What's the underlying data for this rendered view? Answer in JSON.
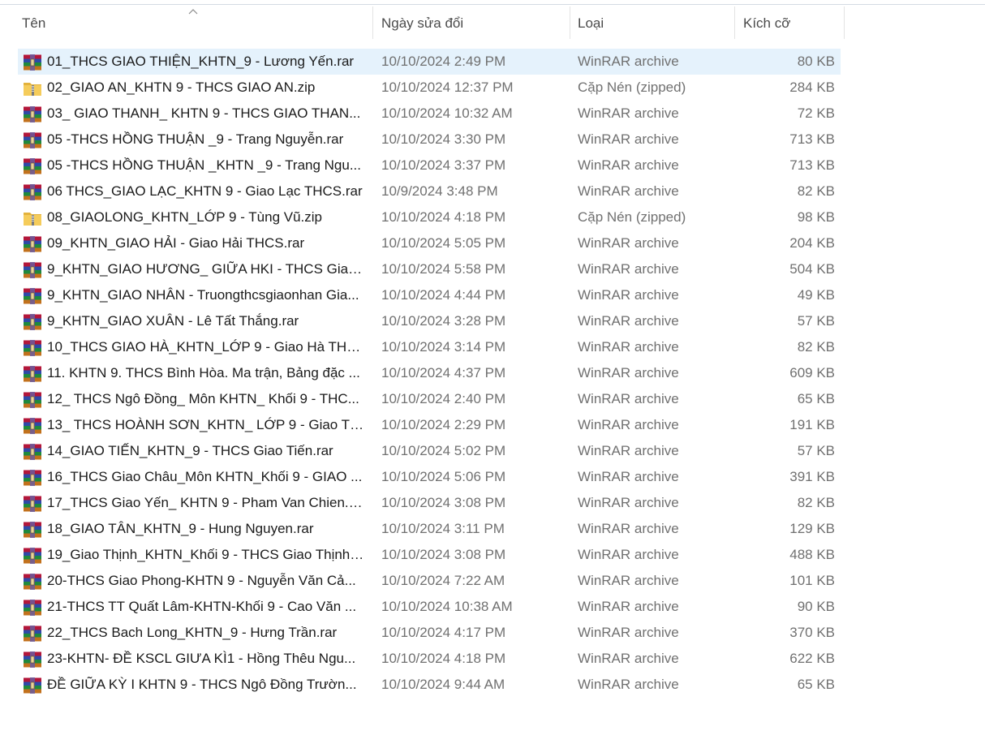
{
  "columns": {
    "name": "Tên",
    "date": "Ngày sửa đổi",
    "type": "Loại",
    "size": "Kích cỡ"
  },
  "sort": {
    "column": "name",
    "direction": "ascending",
    "indicator": "chevron-up-icon"
  },
  "selected_index": 0,
  "colors": {
    "selected": "#e5f2fc",
    "secondary_text": "#707070"
  },
  "files": [
    {
      "icon": "winrar-archive-icon",
      "name": "01_THCS GIAO THIỆN_KHTN_9 - Lương Yến.rar",
      "date": "10/10/2024 2:49 PM",
      "type": "WinRAR archive",
      "size": "80 KB"
    },
    {
      "icon": "zip-folder-icon",
      "name": "02_GIAO AN_KHTN 9 - THCS GIAO AN.zip",
      "date": "10/10/2024 12:37 PM",
      "type": "Cặp Nén (zipped)",
      "size": "284 KB"
    },
    {
      "icon": "winrar-archive-icon",
      "name": "03_ GIAO THANH_ KHTN 9 - THCS GIAO THAN...",
      "date": "10/10/2024 10:32 AM",
      "type": "WinRAR archive",
      "size": "72 KB"
    },
    {
      "icon": "winrar-archive-icon",
      "name": "05 -THCS HỒNG THUẬN _9 - Trang Nguyễn.rar",
      "date": "10/10/2024 3:30 PM",
      "type": "WinRAR archive",
      "size": "713 KB"
    },
    {
      "icon": "winrar-archive-icon",
      "name": "05 -THCS HỒNG THUẬN _KHTN _9 - Trang Ngu...",
      "date": "10/10/2024 3:37 PM",
      "type": "WinRAR archive",
      "size": "713 KB"
    },
    {
      "icon": "winrar-archive-icon",
      "name": "06 THCS_GIAO LẠC_KHTN 9 - Giao Lạc THCS.rar",
      "date": "10/9/2024 3:48 PM",
      "type": "WinRAR archive",
      "size": "82 KB"
    },
    {
      "icon": "zip-folder-icon",
      "name": "08_GIAOLONG_KHTN_LỚP 9 - Tùng Vũ.zip",
      "date": "10/10/2024 4:18 PM",
      "type": "Cặp Nén (zipped)",
      "size": "98 KB"
    },
    {
      "icon": "winrar-archive-icon",
      "name": "09_KHTN_GIAO HẢI - Giao Hải THCS.rar",
      "date": "10/10/2024 5:05 PM",
      "type": "WinRAR archive",
      "size": "204 KB"
    },
    {
      "icon": "winrar-archive-icon",
      "name": "9_KHTN_GIAO HƯƠNG_ GIỮA HKI - THCS Giao ...",
      "date": "10/10/2024 5:58 PM",
      "type": "WinRAR archive",
      "size": "504 KB"
    },
    {
      "icon": "winrar-archive-icon",
      "name": "9_KHTN_GIAO NHÂN - Truongthcsgiaonhan Gia...",
      "date": "10/10/2024 4:44 PM",
      "type": "WinRAR archive",
      "size": "49 KB"
    },
    {
      "icon": "winrar-archive-icon",
      "name": "9_KHTN_GIAO XUÂN - Lê Tất Thắng.rar",
      "date": "10/10/2024 3:28 PM",
      "type": "WinRAR archive",
      "size": "57 KB"
    },
    {
      "icon": "winrar-archive-icon",
      "name": "10_THCS GIAO HÀ_KHTN_LỚP 9 - Giao Hà THC...",
      "date": "10/10/2024 3:14 PM",
      "type": "WinRAR archive",
      "size": "82 KB"
    },
    {
      "icon": "winrar-archive-icon",
      "name": "11. KHTN 9. THCS Bình Hòa. Ma trận, Bảng đặc ...",
      "date": "10/10/2024 4:37 PM",
      "type": "WinRAR archive",
      "size": "609 KB"
    },
    {
      "icon": "winrar-archive-icon",
      "name": "12_ THCS Ngô Đồng_ Môn KHTN_ Khối 9 - THC...",
      "date": "10/10/2024 2:40 PM",
      "type": "WinRAR archive",
      "size": "65 KB"
    },
    {
      "icon": "winrar-archive-icon",
      "name": "13_ THCS HOÀNH SƠN_KHTN_ LỚP 9 - Giao Th...",
      "date": "10/10/2024 2:29 PM",
      "type": "WinRAR archive",
      "size": "191 KB"
    },
    {
      "icon": "winrar-archive-icon",
      "name": "14_GIAO TIẾN_KHTN_9 - THCS Giao Tiến.rar",
      "date": "10/10/2024 5:02 PM",
      "type": "WinRAR archive",
      "size": "57 KB"
    },
    {
      "icon": "winrar-archive-icon",
      "name": "16_THCS Giao Châu_Môn KHTN_Khối 9 - GIAO ...",
      "date": "10/10/2024 5:06 PM",
      "type": "WinRAR archive",
      "size": "391 KB"
    },
    {
      "icon": "winrar-archive-icon",
      "name": "17_THCS Giao Yến_ KHTN 9 - Pham Van Chien.rar",
      "date": "10/10/2024 3:08 PM",
      "type": "WinRAR archive",
      "size": "82 KB"
    },
    {
      "icon": "winrar-archive-icon",
      "name": "18_GIAO TÂN_KHTN_9 - Hung Nguyen.rar",
      "date": "10/10/2024 3:11 PM",
      "type": "WinRAR archive",
      "size": "129 KB"
    },
    {
      "icon": "winrar-archive-icon",
      "name": "19_Giao Thịnh_KHTN_Khối 9 - THCS Giao Thịnh ...",
      "date": "10/10/2024 3:08 PM",
      "type": "WinRAR archive",
      "size": "488 KB"
    },
    {
      "icon": "winrar-archive-icon",
      "name": "20-THCS Giao Phong-KHTN 9 - Nguyễn Văn Cả...",
      "date": "10/10/2024 7:22 AM",
      "type": "WinRAR archive",
      "size": "101 KB"
    },
    {
      "icon": "winrar-archive-icon",
      "name": "21-THCS TT Quất Lâm-KHTN-Khối 9 - Cao Văn ...",
      "date": "10/10/2024 10:38 AM",
      "type": "WinRAR archive",
      "size": "90 KB"
    },
    {
      "icon": "winrar-archive-icon",
      "name": "22_THCS Bach Long_KHTN_9 - Hưng Trần.rar",
      "date": "10/10/2024 4:17 PM",
      "type": "WinRAR archive",
      "size": "370 KB"
    },
    {
      "icon": "winrar-archive-icon",
      "name": "23-KHTN- ĐỀ KSCL GIƯA KÌ1 - Hồng Thêu Ngu...",
      "date": "10/10/2024 4:18 PM",
      "type": "WinRAR archive",
      "size": "622 KB"
    },
    {
      "icon": "winrar-archive-icon",
      "name": "ĐỀ GIỮA KỲ I KHTN 9 - THCS Ngô Đồng Trườn...",
      "date": "10/10/2024 9:44 AM",
      "type": "WinRAR archive",
      "size": "65 KB"
    }
  ]
}
